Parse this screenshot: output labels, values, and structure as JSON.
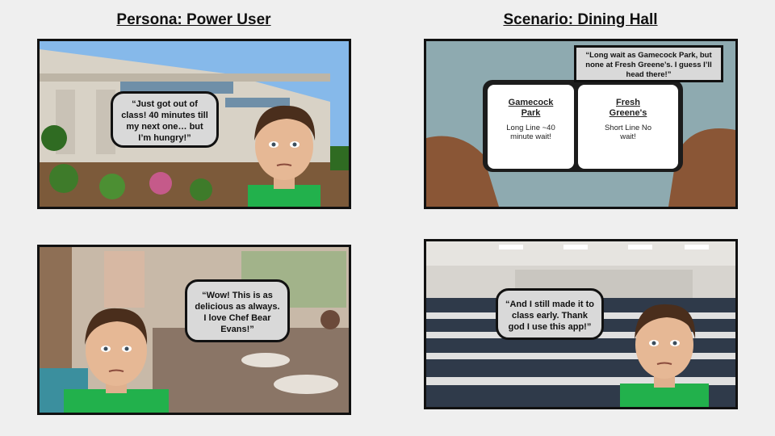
{
  "headings": {
    "left": "Persona: Power User",
    "right": "Scenario: Dining Hall"
  },
  "panels": {
    "p1": {
      "speech": "“Just got out of class! 40 minutes till my next one… but I’m hungry!”"
    },
    "p2": {
      "callout": "“Long wait as Gamecock Park, but none at Fresh Greene’s. I guess I’ll head there!”",
      "left_title": "Gamecock Park",
      "left_body": "Long Line ~40 minute wait!",
      "right_title": "Fresh Greene's",
      "right_body": "Short Line No wait!"
    },
    "p3": {
      "speech": "“Wow! This is as delicious as always. I love Chef Bear Evans!”"
    },
    "p4": {
      "speech": "“And I still made it to class early. Thank god I use this app!”"
    }
  },
  "colors": {
    "shirt": "#22b14c",
    "sky": "#7fb3e6",
    "bubble": "#d9d9d9"
  }
}
